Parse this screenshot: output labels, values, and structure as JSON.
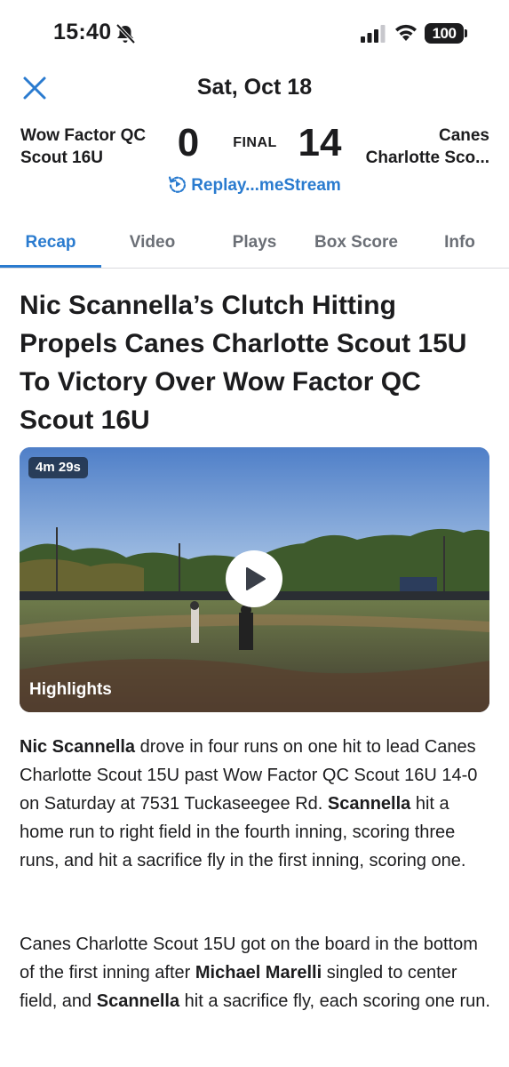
{
  "status_bar": {
    "time": "15:40",
    "battery": "100",
    "icons": [
      "bell-slash-icon",
      "signal-icon",
      "wifi-icon",
      "battery-icon"
    ]
  },
  "header": {
    "date": "Sat, Oct 18",
    "close_icon": "close-icon"
  },
  "game": {
    "home_team": "Wow Factor QC Scout 16U",
    "home_score": "0",
    "status": "FINAL",
    "away_score": "14",
    "away_team_line1": "Canes",
    "away_team_line2": "Charlotte Sco...",
    "replay_label": "Replay...meStream"
  },
  "tabs": [
    {
      "label": "Recap",
      "active": true
    },
    {
      "label": "Video",
      "active": false
    },
    {
      "label": "Plays",
      "active": false
    },
    {
      "label": "Box Score",
      "active": false
    },
    {
      "label": "Info",
      "active": false
    }
  ],
  "article": {
    "headline": "Nic Scannella’s Clutch Hitting Propels Canes Charlotte Scout 15U To Victory Over Wow Factor QC Scout 16U",
    "video": {
      "duration": "4m 29s",
      "caption": "Highlights"
    },
    "paragraph1": [
      {
        "text": "Nic Scannella",
        "bold": true
      },
      {
        "text": " drove in four runs on one hit to lead Canes Charlotte Scout 15U past Wow Factor QC Scout 16U 14-0 on Saturday at 7531 Tuckaseegee Rd. ",
        "bold": false
      },
      {
        "text": "Scannella",
        "bold": true
      },
      {
        "text": " hit a home run to right field in the fourth inning, scoring three runs, and hit a sacrifice fly in the first inning, scoring one.",
        "bold": false
      }
    ],
    "paragraph2": [
      {
        "text": "Canes Charlotte Scout 15U got on the board in the bottom of the first inning after ",
        "bold": false
      },
      {
        "text": "Michael Marelli",
        "bold": true
      },
      {
        "text": " singled to center field, and ",
        "bold": false
      },
      {
        "text": "Scannella",
        "bold": true
      },
      {
        "text": " hit a sacrifice fly, each scoring one run.",
        "bold": false
      }
    ]
  },
  "colors": {
    "accent": "#2a7bcf",
    "text": "#1c1c1e",
    "tab_inactive": "#6b6f76"
  }
}
